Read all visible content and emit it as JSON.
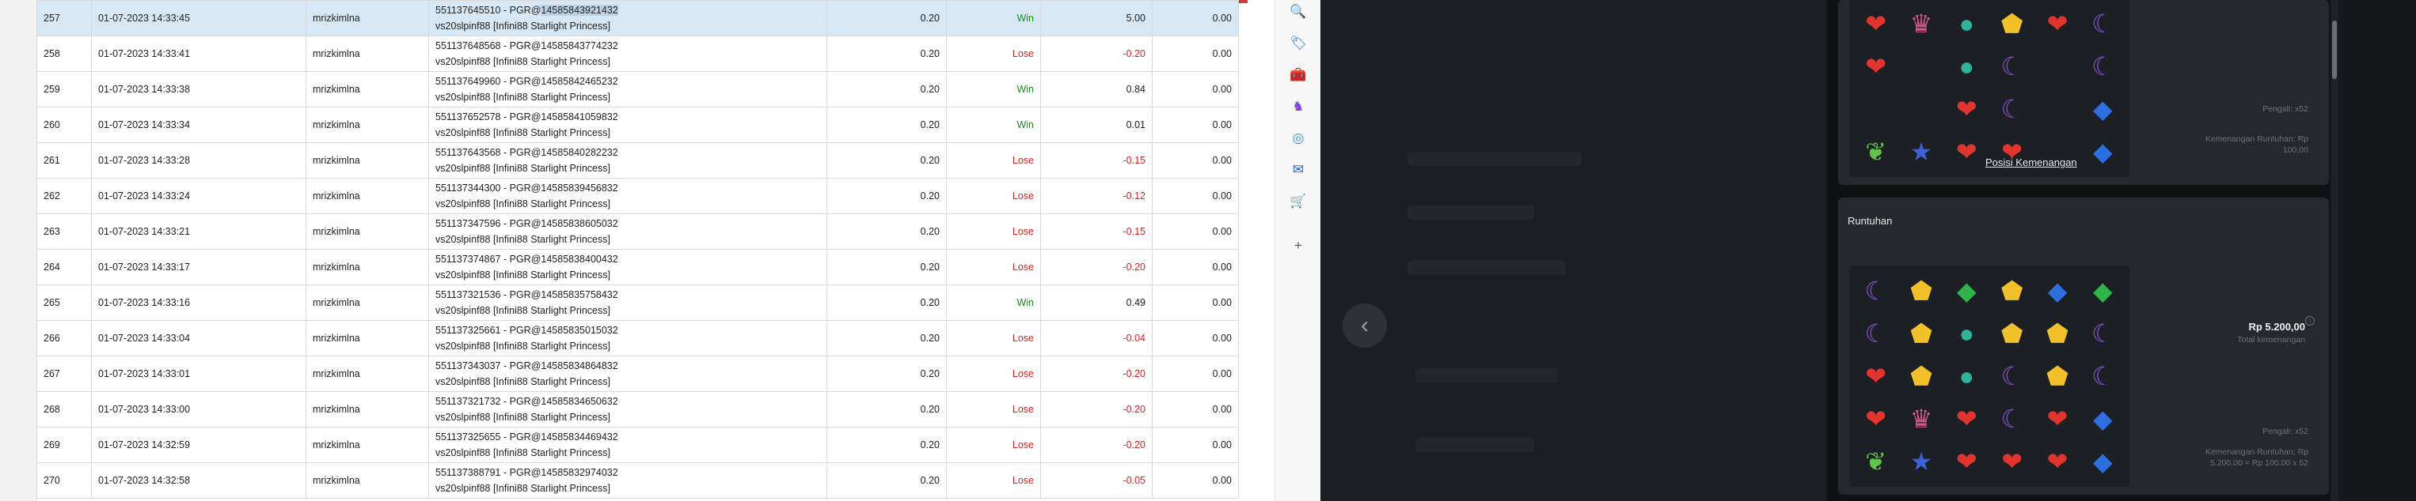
{
  "history": {
    "rows": [
      {
        "num": "257",
        "date": "01-07-2023 14:33:45",
        "user": "mrizkimlna",
        "ref_id": "551137645510",
        "ref_pre": "PGR@",
        "ref_hl": "14585843921432",
        "game": "vs20slpinf88 [Infini88 Starlight Princess]",
        "bet": "0.20",
        "result": "Win",
        "amount": "5.00",
        "balance": "0.00",
        "selected": true
      },
      {
        "num": "258",
        "date": "01-07-2023 14:33:41",
        "user": "mrizkimlna",
        "ref_id": "551137648568",
        "ref_pre": "PGR@14585843774232",
        "ref_hl": "",
        "game": "vs20slpinf88 [Infini88 Starlight Princess]",
        "bet": "0.20",
        "result": "Lose",
        "amount": "-0.20",
        "balance": "0.00"
      },
      {
        "num": "259",
        "date": "01-07-2023 14:33:38",
        "user": "mrizkimlna",
        "ref_id": "551137649960",
        "ref_pre": "PGR@14585842465232",
        "ref_hl": "",
        "game": "vs20slpinf88 [Infini88 Starlight Princess]",
        "bet": "0.20",
        "result": "Win",
        "amount": "0.84",
        "balance": "0.00"
      },
      {
        "num": "260",
        "date": "01-07-2023 14:33:34",
        "user": "mrizkimlna",
        "ref_id": "551137652578",
        "ref_pre": "PGR@14585841059832",
        "ref_hl": "",
        "game": "vs20slpinf88 [Infini88 Starlight Princess]",
        "bet": "0.20",
        "result": "Win",
        "amount": "0.01",
        "balance": "0.00"
      },
      {
        "num": "261",
        "date": "01-07-2023 14:33:28",
        "user": "mrizkimlna",
        "ref_id": "551137643568",
        "ref_pre": "PGR@14585840282232",
        "ref_hl": "",
        "game": "vs20slpinf88 [Infini88 Starlight Princess]",
        "bet": "0.20",
        "result": "Lose",
        "amount": "-0.15",
        "balance": "0.00"
      },
      {
        "num": "262",
        "date": "01-07-2023 14:33:24",
        "user": "mrizkimlna",
        "ref_id": "551137344300",
        "ref_pre": "PGR@14585839456832",
        "ref_hl": "",
        "game": "vs20slpinf88 [Infini88 Starlight Princess]",
        "bet": "0.20",
        "result": "Lose",
        "amount": "-0.12",
        "balance": "0.00"
      },
      {
        "num": "263",
        "date": "01-07-2023 14:33:21",
        "user": "mrizkimlna",
        "ref_id": "551137347596",
        "ref_pre": "PGR@14585838605032",
        "ref_hl": "",
        "game": "vs20slpinf88 [Infini88 Starlight Princess]",
        "bet": "0.20",
        "result": "Lose",
        "amount": "-0.15",
        "balance": "0.00"
      },
      {
        "num": "264",
        "date": "01-07-2023 14:33:17",
        "user": "mrizkimlna",
        "ref_id": "551137374867",
        "ref_pre": "PGR@14585838400432",
        "ref_hl": "",
        "game": "vs20slpinf88 [Infini88 Starlight Princess]",
        "bet": "0.20",
        "result": "Lose",
        "amount": "-0.20",
        "balance": "0.00"
      },
      {
        "num": "265",
        "date": "01-07-2023 14:33:16",
        "user": "mrizkimlna",
        "ref_id": "551137321536",
        "ref_pre": "PGR@14585835758432",
        "ref_hl": "",
        "game": "vs20slpinf88 [Infini88 Starlight Princess]",
        "bet": "0.20",
        "result": "Win",
        "amount": "0.49",
        "balance": "0.00"
      },
      {
        "num": "266",
        "date": "01-07-2023 14:33:04",
        "user": "mrizkimlna",
        "ref_id": "551137325661",
        "ref_pre": "PGR@14585835015032",
        "ref_hl": "",
        "game": "vs20slpinf88 [Infini88 Starlight Princess]",
        "bet": "0.20",
        "result": "Lose",
        "amount": "-0.04",
        "balance": "0.00"
      },
      {
        "num": "267",
        "date": "01-07-2023 14:33:01",
        "user": "mrizkimlna",
        "ref_id": "551137343037",
        "ref_pre": "PGR@14585834864832",
        "ref_hl": "",
        "game": "vs20slpinf88 [Infini88 Starlight Princess]",
        "bet": "0.20",
        "result": "Lose",
        "amount": "-0.20",
        "balance": "0.00"
      },
      {
        "num": "268",
        "date": "01-07-2023 14:33:00",
        "user": "mrizkimlna",
        "ref_id": "551137321732",
        "ref_pre": "PGR@14585834650632",
        "ref_hl": "",
        "game": "vs20slpinf88 [Infini88 Starlight Princess]",
        "bet": "0.20",
        "result": "Lose",
        "amount": "-0.20",
        "balance": "0.00"
      },
      {
        "num": "269",
        "date": "01-07-2023 14:32:59",
        "user": "mrizkimlna",
        "ref_id": "551137325655",
        "ref_pre": "PGR@14585834469432",
        "ref_hl": "",
        "game": "vs20slpinf88 [Infini88 Starlight Princess]",
        "bet": "0.20",
        "result": "Lose",
        "amount": "-0.20",
        "balance": "0.00"
      },
      {
        "num": "270",
        "date": "01-07-2023 14:32:58",
        "user": "mrizkimlna",
        "ref_id": "551137388791",
        "ref_pre": "PGR@14585832974032",
        "ref_hl": "",
        "game": "vs20slpinf88 [Infini88 Starlight Princess]",
        "bet": "0.20",
        "result": "Lose",
        "amount": "-0.05",
        "balance": "0.00"
      }
    ],
    "colors": {
      "win": "#1c8a1c",
      "lose": "#e0201c",
      "selected_row": "#d6e8f5"
    }
  },
  "browser_sidebar": {
    "icons": [
      "search-icon",
      "tag-icon",
      "gift-icon",
      "chess-icon",
      "office-icon",
      "outlook-icon",
      "shopping-icon",
      "plus-icon"
    ]
  },
  "game": {
    "win_card": {
      "pengali": "Pengali: x52",
      "win_line_1": "Kemenangan Runtuhan: Rp",
      "win_line_2": "100,00",
      "link": "Posisi Kemenangan",
      "grid": [
        [
          "heart",
          "crown",
          "ring",
          "gold",
          "heart",
          "chalice"
        ],
        [
          "heart",
          "",
          "ring",
          "chalice",
          "",
          "chalice"
        ],
        [
          "",
          "",
          "heart",
          "chalice",
          "",
          "blue"
        ],
        [
          "wing",
          "star",
          "heart",
          "heart",
          "",
          "blue"
        ]
      ]
    },
    "runtuhan_card": {
      "title": "Runtuhan",
      "total_amount": "Rp 5.200,00",
      "total_label": "Total kemenangan",
      "pengali": "Pengali: x52",
      "win_line_1": "Kemenangan Runtuhan: Rp",
      "win_line_2": "5.200,00 = Rp 100,00 x 52",
      "grid": [
        [
          "chalice",
          "gold",
          "green",
          "gold",
          "blue",
          "green"
        ],
        [
          "chalice",
          "gold",
          "ring",
          "gold",
          "gold",
          "chalice"
        ],
        [
          "heart",
          "gold",
          "ring",
          "chalice",
          "gold",
          "chalice"
        ],
        [
          "heart",
          "crown",
          "heart",
          "chalice",
          "heart",
          "blue"
        ],
        [
          "wing",
          "star",
          "heart",
          "heart",
          "heart",
          "blue"
        ]
      ]
    },
    "gem_glyphs": {
      "heart": "❤",
      "crown": "♛",
      "ring": "●",
      "gold": "⬟",
      "chalice": "☾",
      "blue": "◆",
      "green": "◆",
      "wing": "❦",
      "star": "★"
    },
    "gem_colors": {
      "heart": "#e2342f",
      "crown": "#d05a8c",
      "ring": "#2fb39a",
      "gold": "#f2c02a",
      "chalice": "#8a4fd1",
      "blue": "#2e6fe0",
      "green": "#2fb34a",
      "wing": "#5fc24a",
      "star": "#3b62d8"
    }
  }
}
